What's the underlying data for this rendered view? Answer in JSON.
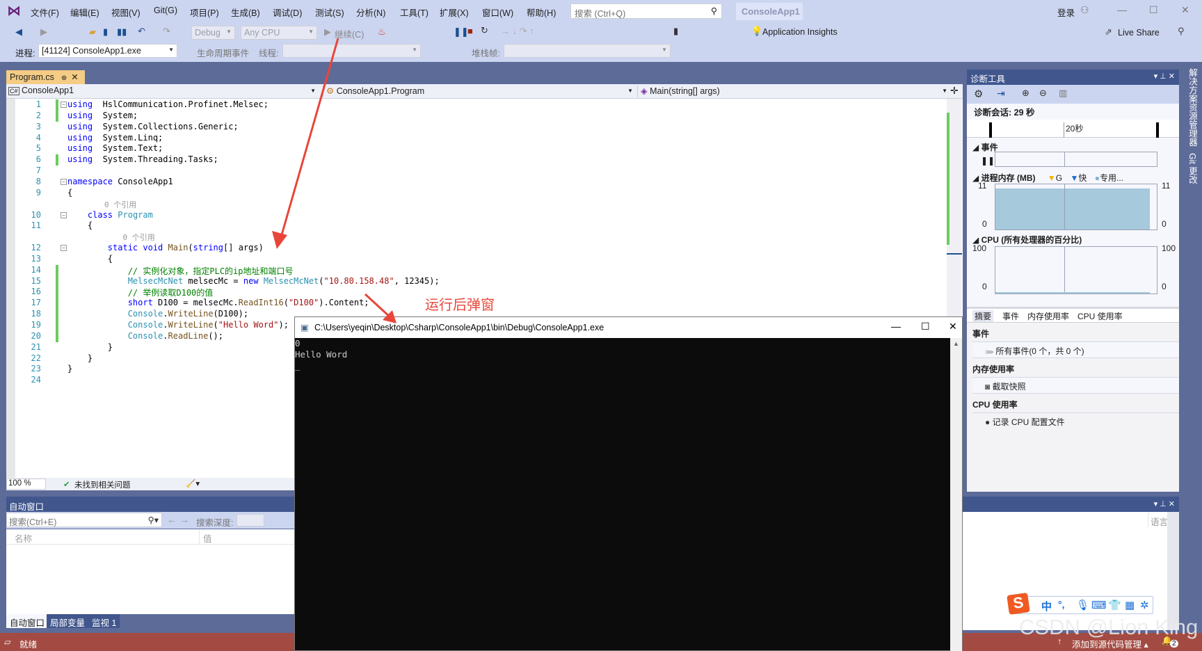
{
  "window": {
    "title": "ConsoleApp1",
    "search_placeholder": "搜索 (Ctrl+Q)",
    "signin": "登录"
  },
  "menu": [
    "文件(F)",
    "编辑(E)",
    "视图(V)",
    "Git(G)",
    "项目(P)",
    "生成(B)",
    "调试(D)",
    "测试(S)",
    "分析(N)",
    "工具(T)",
    "扩展(X)",
    "窗口(W)",
    "帮助(H)"
  ],
  "toolbar": {
    "config": "Debug",
    "platform": "Any CPU",
    "continue": "继续(C)",
    "app_insights": "Application Insights",
    "live_share": "Live Share"
  },
  "toolbar2": {
    "process_label": "进程:",
    "process": "[41124] ConsoleApp1.exe",
    "lifecycle": "生命周期事件",
    "thread_label": "线程:",
    "stackframe_label": "堆栈帧:"
  },
  "editor": {
    "tab": "Program.cs",
    "nav_project": "ConsoleApp1",
    "nav_class": "ConsoleApp1.Program",
    "nav_member": "Main(string[] args)",
    "lines": [
      {
        "n": "1",
        "tokens": [
          [
            "kw",
            "using"
          ],
          [
            "",
            "  HslCommunication.Profinet.Melsec;"
          ]
        ]
      },
      {
        "n": "2",
        "tokens": [
          [
            "kw",
            "using"
          ],
          [
            "",
            "  System;"
          ]
        ]
      },
      {
        "n": "3",
        "tokens": [
          [
            "kw",
            "using"
          ],
          [
            "",
            "  System.Collections.Generic;"
          ]
        ]
      },
      {
        "n": "4",
        "tokens": [
          [
            "kw",
            "using"
          ],
          [
            "",
            "  System.Linq;"
          ]
        ]
      },
      {
        "n": "5",
        "tokens": [
          [
            "kw",
            "using"
          ],
          [
            "",
            "  System.Text;"
          ]
        ]
      },
      {
        "n": "6",
        "tokens": [
          [
            "kw",
            "using"
          ],
          [
            "",
            "  System.Threading.Tasks;"
          ]
        ]
      },
      {
        "n": "7",
        "tokens": []
      },
      {
        "n": "8",
        "tokens": [
          [
            "kw",
            "namespace"
          ],
          [
            "",
            " ConsoleApp1"
          ]
        ]
      },
      {
        "n": "9",
        "tokens": [
          [
            "",
            "{"
          ]
        ]
      },
      {
        "n": "",
        "tokens": [
          [
            "hint",
            "        0 个引用"
          ]
        ]
      },
      {
        "n": "10",
        "tokens": [
          [
            "",
            "    "
          ],
          [
            "kw",
            "class"
          ],
          [
            "",
            " "
          ],
          [
            "ty",
            "Program"
          ]
        ]
      },
      {
        "n": "11",
        "tokens": [
          [
            "",
            "    {"
          ]
        ]
      },
      {
        "n": "",
        "tokens": [
          [
            "hint",
            "            0 个引用"
          ]
        ]
      },
      {
        "n": "12",
        "tokens": [
          [
            "",
            "        "
          ],
          [
            "kw",
            "static void"
          ],
          [
            "",
            " "
          ],
          [
            "mt",
            "Main"
          ],
          [
            "",
            "("
          ],
          [
            "kw",
            "string"
          ],
          [
            "",
            "[] args)"
          ]
        ]
      },
      {
        "n": "13",
        "tokens": [
          [
            "",
            "        {"
          ]
        ]
      },
      {
        "n": "14",
        "tokens": [
          [
            "cm",
            "            // 实例化对象，指定PLC的ip地址和端口号"
          ]
        ]
      },
      {
        "n": "15",
        "tokens": [
          [
            "",
            "            "
          ],
          [
            "ty",
            "MelsecMcNet"
          ],
          [
            "",
            " melsecMc = "
          ],
          [
            "kw",
            "new"
          ],
          [
            "",
            " "
          ],
          [
            "ty",
            "MelsecMcNet"
          ],
          [
            "",
            "("
          ],
          [
            "st",
            "\"10.80.158.48\""
          ],
          [
            "",
            ", 12345);"
          ]
        ]
      },
      {
        "n": "16",
        "tokens": [
          [
            "cm",
            "            // 举例读取D100的值"
          ]
        ]
      },
      {
        "n": "17",
        "tokens": [
          [
            "",
            "            "
          ],
          [
            "kw",
            "short"
          ],
          [
            "",
            " D100 = melsecMc."
          ],
          [
            "mt",
            "ReadInt16"
          ],
          [
            "",
            "("
          ],
          [
            "st",
            "\"D100\""
          ],
          [
            "",
            ").Content;"
          ]
        ]
      },
      {
        "n": "18",
        "tokens": [
          [
            "",
            "            "
          ],
          [
            "ty",
            "Console"
          ],
          [
            "",
            "."
          ],
          [
            "mt",
            "WriteLine"
          ],
          [
            "",
            "(D100);"
          ]
        ]
      },
      {
        "n": "19",
        "tokens": [
          [
            "",
            "            "
          ],
          [
            "ty",
            "Console"
          ],
          [
            "",
            "."
          ],
          [
            "mt",
            "WriteLine"
          ],
          [
            "",
            "("
          ],
          [
            "st",
            "\"Hello Word\""
          ],
          [
            "",
            ");"
          ]
        ]
      },
      {
        "n": "20",
        "tokens": [
          [
            "",
            "            "
          ],
          [
            "ty",
            "Console"
          ],
          [
            "",
            "."
          ],
          [
            "mt",
            "ReadLine"
          ],
          [
            "",
            "();"
          ]
        ]
      },
      {
        "n": "21",
        "tokens": [
          [
            "",
            "        }"
          ]
        ]
      },
      {
        "n": "22",
        "tokens": [
          [
            "",
            "    }"
          ]
        ]
      },
      {
        "n": "23",
        "tokens": [
          [
            "",
            "}"
          ]
        ]
      },
      {
        "n": "24",
        "tokens": []
      }
    ],
    "zoom": "100 %",
    "issues": "未找到相关问题"
  },
  "annotation": "运行后弹窗",
  "console": {
    "title": "C:\\Users\\yeqin\\Desktop\\Csharp\\ConsoleApp1\\bin\\Debug\\ConsoleApp1.exe",
    "output": "0\nHello Word\n_"
  },
  "autos": {
    "title": "自动窗口",
    "search_placeholder": "搜索(Ctrl+E)",
    "depth_label": "搜索深度:",
    "col_name": "名称",
    "col_value": "值",
    "tabs": [
      "自动窗口",
      "局部变量",
      "监视 1"
    ]
  },
  "diagnostics": {
    "title": "诊断工具",
    "session": "诊断会话: 29 秒",
    "timeline_tick": "20秒",
    "events_label": "事件",
    "memory_label": "进程内存 (MB)",
    "legend": [
      "G",
      "快",
      "专用..."
    ],
    "mem_max": "11",
    "mem_min": "0",
    "cpu_label": "CPU (所有处理器的百分比)",
    "cpu_max": "100",
    "cpu_min": "0",
    "tabs": [
      "摘要",
      "事件",
      "内存使用率",
      "CPU 使用率"
    ],
    "sections": [
      {
        "h": "事件",
        "item": "所有事件(0 个，共 0 个)"
      },
      {
        "h": "内存使用率",
        "item": "截取快照"
      },
      {
        "h": "CPU 使用率",
        "item": "记录 CPU 配置文件"
      }
    ]
  },
  "right_tabs": [
    "解决方案资源管理器",
    "Git 更改"
  ],
  "output": {
    "col": "语言"
  },
  "ime": [
    "中",
    "°,"
  ],
  "status": {
    "ready": "就绪",
    "source_control": "添加到源代码管理",
    "notifications": "2"
  },
  "watermark": "CSDN @Lion King"
}
